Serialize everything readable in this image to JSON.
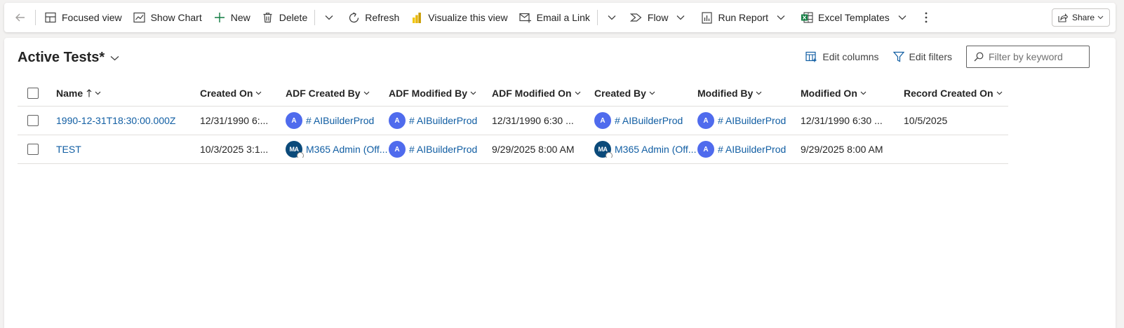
{
  "toolbar": {
    "focused_view": "Focused view",
    "show_chart": "Show Chart",
    "new": "New",
    "delete": "Delete",
    "refresh": "Refresh",
    "visualize": "Visualize this view",
    "email_link": "Email a Link",
    "flow": "Flow",
    "run_report": "Run Report",
    "excel_templates": "Excel Templates",
    "share": "Share"
  },
  "view": {
    "title": "Active Tests*",
    "edit_columns": "Edit columns",
    "edit_filters": "Edit filters",
    "filter_placeholder": "Filter by keyword"
  },
  "grid": {
    "columns": {
      "name": "Name",
      "created_on": "Created On",
      "adf_created_by": "ADF Created By",
      "adf_modified_by": "ADF Modified By",
      "adf_modified_on": "ADF Modified On",
      "created_by": "Created By",
      "modified_by": "Modified By",
      "modified_on": "Modified On",
      "record_created_on": "Record Created On"
    },
    "rows": [
      {
        "name": "1990-12-31T18:30:00.000Z",
        "created_on": "12/31/1990 6:...",
        "adf_created_by": "# AIBuilderProd",
        "adf_created_by_initials": "A",
        "adf_modified_by": "# AIBuilderProd",
        "adf_modified_by_initials": "A",
        "adf_modified_on": "12/31/1990 6:30 ...",
        "created_by": "# AIBuilderProd",
        "created_by_initials": "A",
        "modified_by": "# AIBuilderProd",
        "modified_by_initials": "A",
        "modified_on": "12/31/1990 6:30 ...",
        "record_created_on": "10/5/2025"
      },
      {
        "name": "TEST",
        "created_on": "10/3/2025 3:1...",
        "adf_created_by": "M365 Admin (Off...",
        "adf_created_by_initials": "MA",
        "adf_modified_by": "# AIBuilderProd",
        "adf_modified_by_initials": "A",
        "adf_modified_on": "9/29/2025 8:00 AM",
        "created_by": "M365 Admin (Off...",
        "created_by_initials": "MA",
        "modified_by": "# AIBuilderProd",
        "modified_by_initials": "A",
        "modified_on": "9/29/2025 8:00 AM",
        "record_created_on": ""
      }
    ]
  },
  "colors": {
    "link": "#115ea3",
    "avatar_blue": "#4f6bed",
    "avatar_dark": "#0b4a7a",
    "excel_green": "#107c41",
    "powerbi_yellow": "#f2c811"
  }
}
